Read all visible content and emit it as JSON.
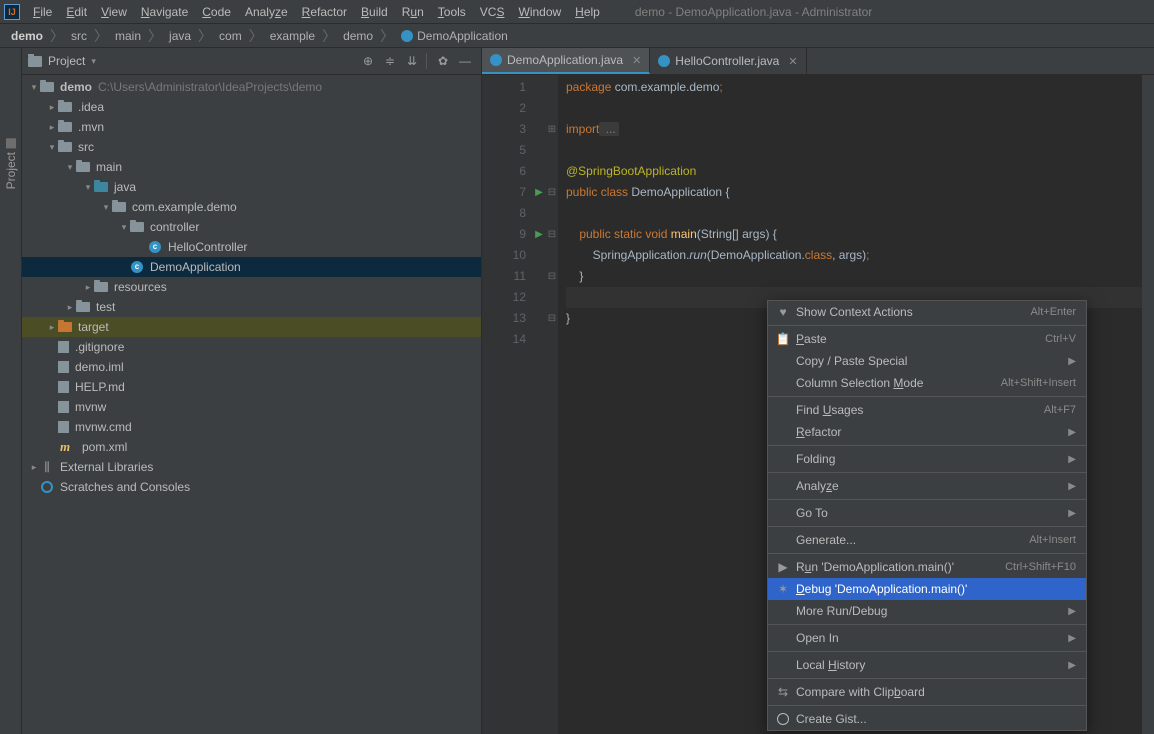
{
  "window_title": "demo - DemoApplication.java - Administrator",
  "menu": [
    "File",
    "Edit",
    "View",
    "Navigate",
    "Code",
    "Analyze",
    "Refactor",
    "Build",
    "Run",
    "Tools",
    "VCS",
    "Window",
    "Help"
  ],
  "breadcrumb": [
    "demo",
    "src",
    "main",
    "java",
    "com",
    "example",
    "demo",
    "DemoApplication"
  ],
  "left_tab": "Project",
  "project_panel": {
    "title": "Project"
  },
  "tree": {
    "root": {
      "name": "demo",
      "path": "C:\\Users\\Administrator\\IdeaProjects\\demo"
    },
    "idea": ".idea",
    "mvn": ".mvn",
    "src": "src",
    "main_dir": "main",
    "java_dir": "java",
    "pkg": "com.example.demo",
    "controller": "controller",
    "hello": "HelloController",
    "app": "DemoApplication",
    "resources": "resources",
    "test": "test",
    "target": "target",
    "gitignore": ".gitignore",
    "iml": "demo.iml",
    "help": "HELP.md",
    "mvnw": "mvnw",
    "mvnwcmd": "mvnw.cmd",
    "pom": "pom.xml",
    "extlib": "External Libraries",
    "scratch": "Scratches and Consoles"
  },
  "tabs": [
    {
      "label": "DemoApplication.java"
    },
    {
      "label": "HelloController.java"
    }
  ],
  "line_numbers": [
    "1",
    "2",
    "3",
    "5",
    "6",
    "7",
    "8",
    "9",
    "10",
    "11",
    "12",
    "13",
    "14"
  ],
  "code": {
    "l1a": "package",
    "l1b": " com.example.demo",
    "l1c": ";",
    "l3a": "import",
    "l3b": " ...",
    "l6": "@SpringBootApplication",
    "l7a": "public ",
    "l7b": "class ",
    "l7c": "DemoApplication ",
    "l7d": "{",
    "l9a": "    public ",
    "l9b": "static ",
    "l9c": "void ",
    "l9d": "main",
    "l9e": "(String[] args) {",
    "l10a": "        SpringApplication.",
    "l10b": "run",
    "l10c": "(DemoApplication.",
    "l10d": "class",
    "l10e": ", args)",
    "l10f": ";",
    "l11": "    }",
    "l13": "}"
  },
  "ctx": {
    "show_actions": "Show Context Actions",
    "show_actions_sc": "Alt+Enter",
    "paste": "Paste",
    "paste_sc": "Ctrl+V",
    "copy_paste_special": "Copy / Paste Special",
    "col_sel": "Column Selection Mode",
    "col_sel_sc": "Alt+Shift+Insert",
    "find_usages": "Find Usages",
    "find_usages_sc": "Alt+F7",
    "refactor": "Refactor",
    "folding": "Folding",
    "analyze": "Analyze",
    "goto": "Go To",
    "generate": "Generate...",
    "generate_sc": "Alt+Insert",
    "run": "Run 'DemoApplication.main()'",
    "run_sc": "Ctrl+Shift+F10",
    "debug": "Debug 'DemoApplication.main()'",
    "more_run": "More Run/Debug",
    "open_in": "Open In",
    "local_hist": "Local History",
    "compare": "Compare with Clipboard",
    "gist": "Create Gist..."
  }
}
